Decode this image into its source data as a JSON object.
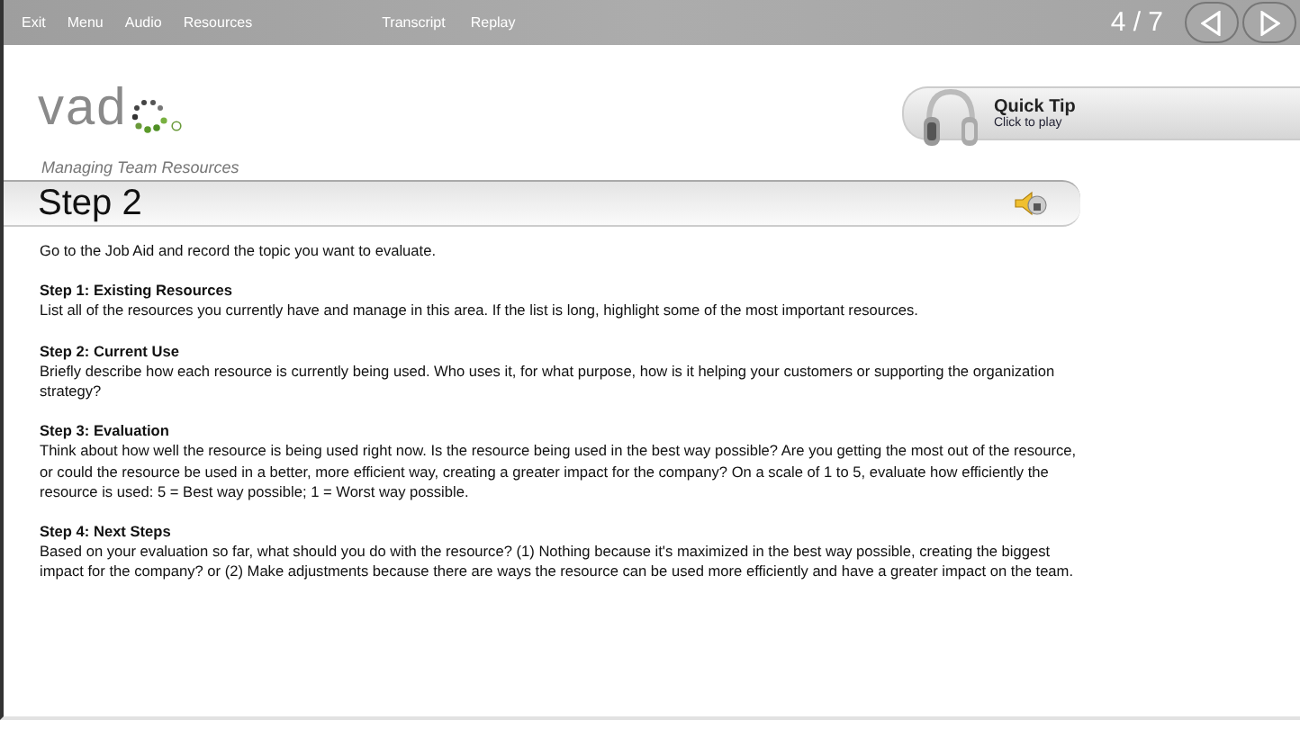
{
  "toolbar": {
    "menu_left": [
      "Exit",
      "Menu",
      "Audio",
      "Resources"
    ],
    "menu_center": [
      "Transcript",
      "Replay"
    ],
    "page_counter": "4 / 7"
  },
  "logo": {
    "text": "vad"
  },
  "course_title": "Managing Team Resources",
  "quick_tip": {
    "title": "Quick Tip",
    "subtitle": "Click to play"
  },
  "step_title": "Step 2",
  "intro": "Go to the Job Aid and record the topic you want to evaluate.",
  "sections": [
    {
      "heading": "Step 1: Existing Resources",
      "text": "List all of the resources you currently have and manage in this area. If the list is long, highlight some of the most important resources."
    },
    {
      "heading": "Step 2: Current Use",
      "text": "Briefly describe how each resource is currently being used. Who uses it, for what purpose, how is it helping your customers or supporting the organization strategy?"
    },
    {
      "heading": "Step 3: Evaluation",
      "text": "Think about how well the resource is being used right now. Is the resource being used in the best way possible? Are you getting the most out of the resource, or could the resource be used in a better, more efficient way, creating a greater impact for the company? On a scale of 1 to 5, evaluate how efficiently the resource is used: 5 = Best way possible; 1 = Worst way possible."
    },
    {
      "heading": "Step 4: Next Steps",
      "text": "Based on your evaluation so far, what should you do with the resource? (1) Nothing because it's maximized in the best way possible, creating the biggest impact for the company? or (2) Make adjustments because there are ways the resource can be used more efficiently and have a greater impact on the team."
    }
  ]
}
